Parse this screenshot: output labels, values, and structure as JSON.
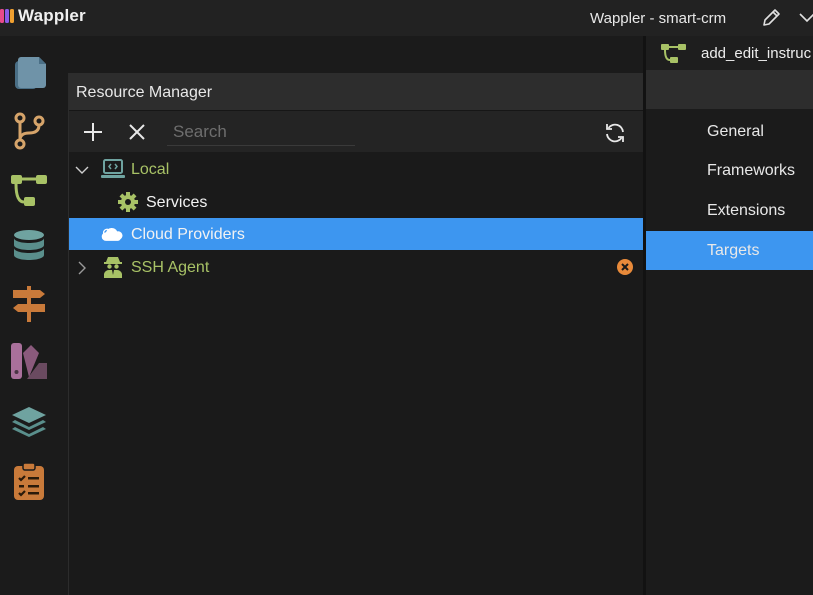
{
  "app": {
    "logo_text": "Wappler",
    "window_title": "Wappler - smart-crm"
  },
  "activity_bar": {
    "icons": [
      "files-icon",
      "git-branch-icon",
      "flow-icon",
      "database-icon",
      "signpost-icon",
      "design-icon",
      "layers-icon",
      "clipboard-tasks-icon"
    ]
  },
  "resource_manager": {
    "title": "Resource Manager",
    "search": {
      "placeholder": "Search",
      "value": ""
    },
    "tree": [
      {
        "label": "Local",
        "icon": "monitor-code-icon",
        "expanded": true,
        "color": "#a8c266"
      },
      {
        "label": "Services",
        "icon": "gear-icon",
        "color": "#f2f2f2"
      },
      {
        "label": "Cloud Providers",
        "icon": "cloud-icon",
        "selected": true,
        "color": "#f2f2f2"
      },
      {
        "label": "SSH Agent",
        "icon": "spy-agent-icon",
        "expanded": false,
        "color": "#a8c266"
      }
    ]
  },
  "right_panel": {
    "file_label": "add_edit_instruc",
    "nav": [
      {
        "label": "General"
      },
      {
        "label": "Frameworks"
      },
      {
        "label": "Extensions"
      },
      {
        "label": "Targets",
        "active": true
      }
    ]
  },
  "colors": {
    "accent": "#3d96f0",
    "green_label": "#a8c266",
    "warning": "#e88a3a"
  }
}
